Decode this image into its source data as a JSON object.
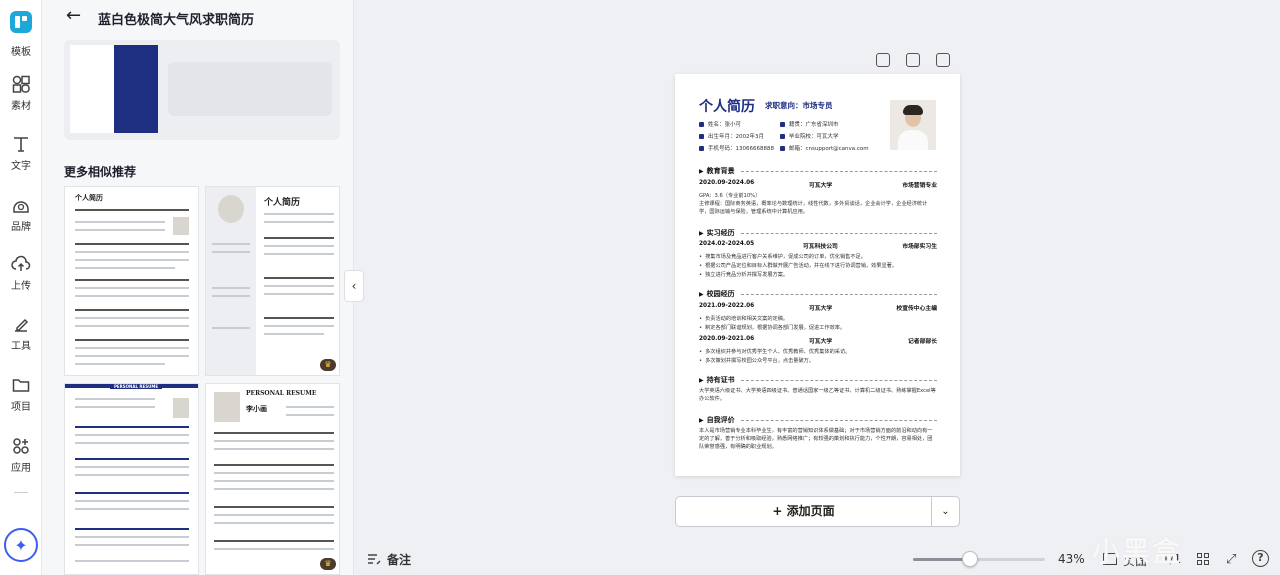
{
  "rail": {
    "items": [
      {
        "label": "模板",
        "icon": "template-icon"
      },
      {
        "label": "素材",
        "icon": "elements-icon"
      },
      {
        "label": "文字",
        "icon": "text-icon"
      },
      {
        "label": "品牌",
        "icon": "brand-icon"
      },
      {
        "label": "上传",
        "icon": "upload-icon"
      },
      {
        "label": "工具",
        "icon": "tools-icon"
      },
      {
        "label": "项目",
        "icon": "projects-icon"
      },
      {
        "label": "应用",
        "icon": "apps-icon"
      }
    ]
  },
  "panel": {
    "title": "蓝白色极简大气风求职简历",
    "more_title": "更多相似推荐",
    "templates": [
      {
        "title": "个人简历"
      },
      {
        "title": "个人简历"
      },
      {
        "title": "PERSONAL RESUME"
      },
      {
        "title": "PERSONAL RESUME",
        "name": "李小画"
      }
    ]
  },
  "resume": {
    "title": "个人简历",
    "intent": "求职意向：市场专员",
    "info": [
      "姓名：张小可",
      "籍贯：广东省深圳市",
      "出生年月：2002年3月",
      "毕业院校：可瓦大学",
      "手机号码：13066668888",
      "邮箱：cnsupport@canva.com"
    ],
    "sections": {
      "education": "教育背景",
      "internship": "实习经历",
      "campus": "校园经历",
      "certs": "持有证书",
      "self": "自我评价"
    },
    "edu_row": [
      "2020.09-2024.06",
      "可瓦大学",
      "市场营销专业"
    ],
    "edu_lines": [
      "GPA：3.6（专业前10%）",
      "主修课程：国际商务英语，概率论与数理统计，线性代数，多外贸谈话，企业会计学，企业经济统计学，国际运输与保险，管理系统中计算机应用。"
    ],
    "intern_row": [
      "2024.02-2024.05",
      "可瓦科技公司",
      "市场部实习生"
    ],
    "intern_bullets": [
      "搜集市场及竞品进行客户关系维护，促成公司的订单，优化销售不足。",
      "根据公司产品定位和目标人群做开展广告活动，并在线下进行协调营销，效果显著。",
      "独立进行竞品分析并撰写发展方案。"
    ],
    "campus_row1": [
      "2021.09-2022.06",
      "可瓦大学",
      "校宣传中心主编"
    ],
    "campus_b1": [
      "负责活动的培训和相关文案的定稿。",
      "制定各部门联谊规划，根据协调各部门发展，促进工作效率。"
    ],
    "campus_row2": [
      "2020.09-2021.06",
      "可瓦大学",
      "记者部部长"
    ],
    "campus_b2": [
      "多次组织并参与对优秀学生个人、优秀教师、优秀集体的采访。",
      "多次策划并撰写校园公众号平台，点击量破万。"
    ],
    "certs_text": "大学英语六级证书、大学英语四级证书、普通话国家一级乙等证书、计算机二级证书、熟练掌握Excel等办公软件。",
    "self_text": "本人是市场营销专业本科毕业生，有丰富的营销知识体系做基础；对于市场营销方面的前沿和动向有一定的了解，善于分析和吸取经验，熟悉网络推广；有较强的策划和执行能力，个性开朗，容易相处，团队荣誉感强，有明确的职业规划。"
  },
  "canvas": {
    "add_page": "+ 添加页面"
  },
  "footer": {
    "notes": "备注",
    "zoom": "43%",
    "zoom_level": 0.43,
    "pages_label": "页面",
    "pages_count": "1/1"
  },
  "watermark": "小黑盒"
}
